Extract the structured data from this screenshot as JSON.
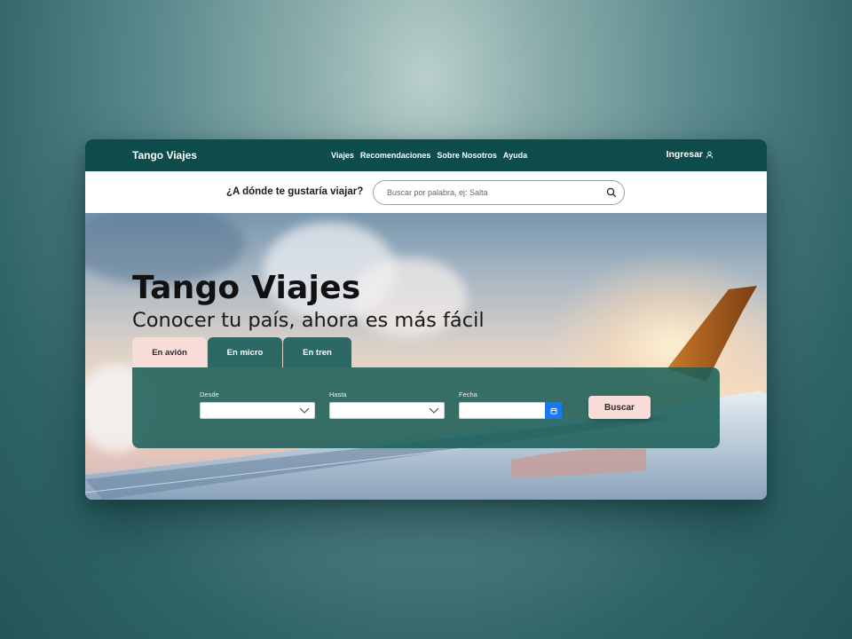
{
  "nav": {
    "brand": "Tango Viajes",
    "menu": [
      {
        "label": "Viajes"
      },
      {
        "label": "Recomendaciones"
      },
      {
        "label": "Sobre Nosotros"
      },
      {
        "label": "Ayuda"
      }
    ],
    "login_label": "Ingresar",
    "login_icon": "user-icon"
  },
  "search": {
    "question": "¿A dónde te gustaría viajar?",
    "placeholder": "Buscar por palabra, ej: Salta",
    "value": "",
    "icon": "search-icon"
  },
  "hero": {
    "title": "Tango Viajes",
    "subtitle": "Conocer tu país, ahora es más fácil"
  },
  "tabs": [
    {
      "label": "En avión",
      "active": true
    },
    {
      "label": "En micro",
      "active": false
    },
    {
      "label": "En tren",
      "active": false
    }
  ],
  "booking": {
    "from_label": "Desde",
    "from_value": "",
    "to_label": "Hasta",
    "to_value": "",
    "date_label": "Fecha",
    "date_value": "",
    "date_icon": "calendar-icon",
    "submit_label": "Buscar"
  },
  "colors": {
    "nav_bg": "#0d4c4a",
    "panel_bg": "#1d6059",
    "accent_pink": "#f7dcd8",
    "date_button": "#1877f2"
  }
}
